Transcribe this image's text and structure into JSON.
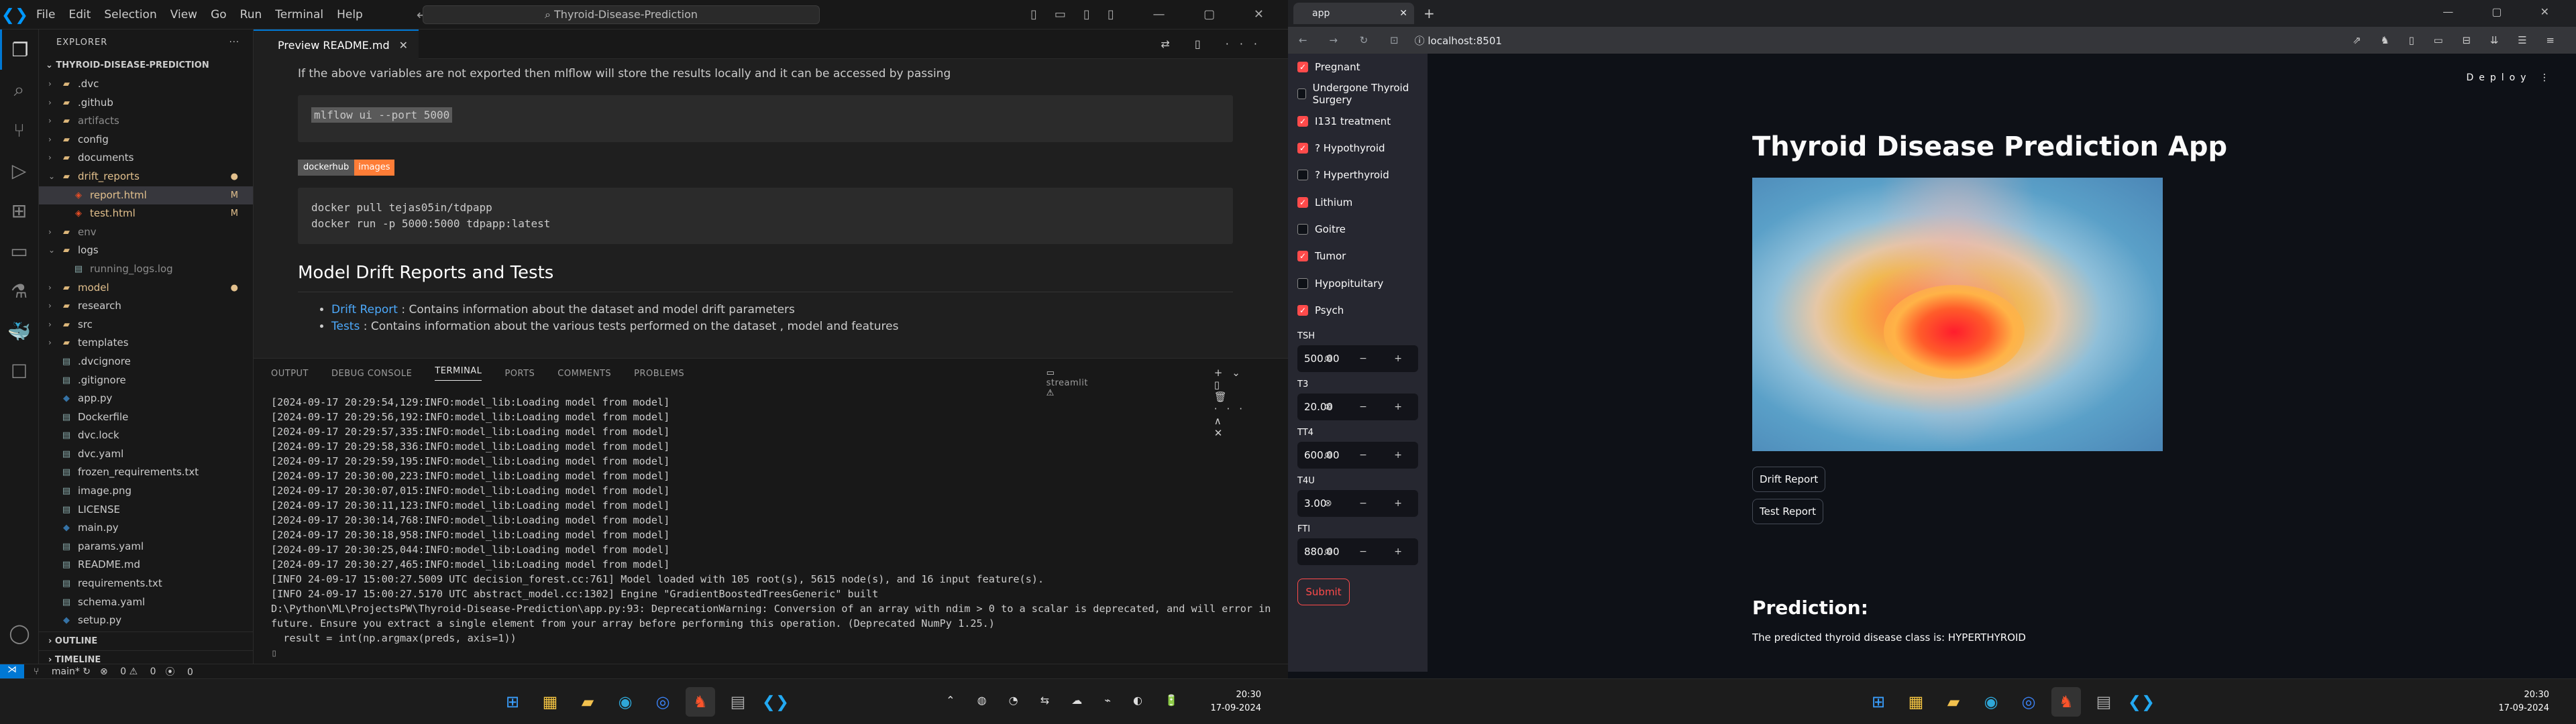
{
  "vscode": {
    "menu": [
      "File",
      "Edit",
      "Selection",
      "View",
      "Go",
      "Run",
      "Terminal",
      "Help"
    ],
    "search": "Thyroid-Disease-Prediction",
    "explorer_title": "EXPLORER",
    "project": "THYROID-DISEASE-PREDICTION",
    "tree": [
      {
        "name": ".dvc",
        "type": "folder",
        "depth": 0
      },
      {
        "name": ".github",
        "type": "folder",
        "depth": 0
      },
      {
        "name": "artifacts",
        "type": "folder",
        "depth": 0,
        "dim": true
      },
      {
        "name": "config",
        "type": "folder",
        "depth": 0
      },
      {
        "name": "documents",
        "type": "folder",
        "depth": 0
      },
      {
        "name": "drift_reports",
        "type": "folder",
        "depth": 0,
        "open": true,
        "mod": true,
        "status": "●"
      },
      {
        "name": "report.html",
        "type": "html",
        "depth": 1,
        "mod": true,
        "status": "M",
        "sel": true
      },
      {
        "name": "test.html",
        "type": "html",
        "depth": 1,
        "mod": true,
        "status": "M"
      },
      {
        "name": "env",
        "type": "folder",
        "depth": 0,
        "dim": true
      },
      {
        "name": "logs",
        "type": "folder",
        "depth": 0,
        "open": true
      },
      {
        "name": "running_logs.log",
        "type": "file",
        "depth": 1,
        "dim": true
      },
      {
        "name": "model",
        "type": "folder",
        "depth": 0,
        "mod": true,
        "status": "●"
      },
      {
        "name": "research",
        "type": "folder",
        "depth": 0
      },
      {
        "name": "src",
        "type": "folder",
        "depth": 0
      },
      {
        "name": "templates",
        "type": "folder",
        "depth": 0
      },
      {
        "name": ".dvcignore",
        "type": "file",
        "depth": 0
      },
      {
        "name": ".gitignore",
        "type": "file",
        "depth": 0
      },
      {
        "name": "app.py",
        "type": "py",
        "depth": 0
      },
      {
        "name": "Dockerfile",
        "type": "file",
        "depth": 0
      },
      {
        "name": "dvc.lock",
        "type": "file",
        "depth": 0
      },
      {
        "name": "dvc.yaml",
        "type": "file",
        "depth": 0
      },
      {
        "name": "frozen_requirements.txt",
        "type": "file",
        "depth": 0
      },
      {
        "name": "image.png",
        "type": "file",
        "depth": 0
      },
      {
        "name": "LICENSE",
        "type": "file",
        "depth": 0
      },
      {
        "name": "main.py",
        "type": "py",
        "depth": 0
      },
      {
        "name": "params.yaml",
        "type": "file",
        "depth": 0
      },
      {
        "name": "README.md",
        "type": "file",
        "depth": 0
      },
      {
        "name": "requirements.txt",
        "type": "file",
        "depth": 0
      },
      {
        "name": "schema.yaml",
        "type": "file",
        "depth": 0
      },
      {
        "name": "setup.py",
        "type": "py",
        "depth": 0
      }
    ],
    "outline": "OUTLINE",
    "timeline": "TIMELINE",
    "tab": "Preview README.md",
    "preview": {
      "para": "If the above variables are not exported then mlflow will store the results locally and it can be accessed by passing",
      "code1": "mlflow ui --port 5000",
      "badge_left": "dockerhub",
      "badge_right": "images",
      "code2a": "docker pull tejas05in/tdpapp",
      "code2b": "docker run -p 5000:5000 tdpapp:latest",
      "h2": "Model Drift Reports and Tests",
      "li1_link": "Drift Report",
      "li1_text": " : Contains information about the dataset and model drift parameters",
      "li2_link": "Tests",
      "li2_text": " : Contains information about the various tests performed on the dataset , model and features"
    },
    "panel_tabs": [
      "OUTPUT",
      "DEBUG CONSOLE",
      "TERMINAL",
      "PORTS",
      "COMMENTS",
      "PROBLEMS"
    ],
    "terminal_name": "streamlit",
    "terminal": [
      "[2024-09-17 20:29:54,129:INFO:model_lib:Loading model from model]",
      "[2024-09-17 20:29:56,192:INFO:model_lib:Loading model from model]",
      "[2024-09-17 20:29:57,335:INFO:model_lib:Loading model from model]",
      "[2024-09-17 20:29:58,336:INFO:model_lib:Loading model from model]",
      "[2024-09-17 20:29:59,195:INFO:model_lib:Loading model from model]",
      "[2024-09-17 20:30:00,223:INFO:model_lib:Loading model from model]",
      "[2024-09-17 20:30:07,015:INFO:model_lib:Loading model from model]",
      "[2024-09-17 20:30:11,123:INFO:model_lib:Loading model from model]",
      "[2024-09-17 20:30:14,768:INFO:model_lib:Loading model from model]",
      "[2024-09-17 20:30:18,958:INFO:model_lib:Loading model from model]",
      "[2024-09-17 20:30:25,044:INFO:model_lib:Loading model from model]",
      "[2024-09-17 20:30:27,465:INFO:model_lib:Loading model from model]",
      "[INFO 24-09-17 15:00:27.5009 UTC decision_forest.cc:761] Model loaded with 105 root(s), 5615 node(s), and 16 input feature(s).",
      "[INFO 24-09-17 15:00:27.5170 UTC abstract_model.cc:1302] Engine \"GradientBoostedTreesGeneric\" built",
      "D:\\Python\\ML\\ProjectsPW\\Thyroid-Disease-Prediction\\app.py:93: DeprecationWarning: Conversion of an array with ndim > 0 to a scalar is deprecated, and will error in future. Ensure you extract a single element from your array before performing this operation. (Deprecated NumPy 1.25.)",
      "  result = int(np.argmax(preds, axis=1))"
    ],
    "status": {
      "branch": "main*",
      "errors": "0",
      "warnings": "0",
      "ports": "0"
    },
    "clock_time": "20:30",
    "clock_date": "17-09-2024"
  },
  "browser": {
    "tab": "app",
    "url": "localhost:8501",
    "deploy": "Deploy",
    "checkboxes": [
      {
        "label": "Pregnant",
        "checked": true
      },
      {
        "label": "Undergone Thyroid Surgery",
        "checked": false
      },
      {
        "label": "I131 treatment",
        "checked": true
      },
      {
        "label": "? Hypothyroid",
        "checked": true
      },
      {
        "label": "? Hyperthyroid",
        "checked": false
      },
      {
        "label": "Lithium",
        "checked": true
      },
      {
        "label": "Goitre",
        "checked": false
      },
      {
        "label": "Tumor",
        "checked": true
      },
      {
        "label": "Hypopituitary",
        "checked": false
      },
      {
        "label": "Psych",
        "checked": true
      }
    ],
    "inputs": [
      {
        "label": "TSH",
        "value": "500.00"
      },
      {
        "label": "T3",
        "value": "20.00"
      },
      {
        "label": "TT4",
        "value": "600.00"
      },
      {
        "label": "T4U",
        "value": "3.00"
      },
      {
        "label": "FTI",
        "value": "880.00"
      }
    ],
    "submit": "Submit",
    "title": "Thyroid Disease Prediction App",
    "btn_drift": "Drift Report",
    "btn_test": "Test Report",
    "pred_heading": "Prediction:",
    "pred_text": "The predicted thyroid disease class is: HYPERTHYROID",
    "clock_time": "20:30",
    "clock_date": "17-09-2024",
    "accent": "#ff4b4b"
  }
}
